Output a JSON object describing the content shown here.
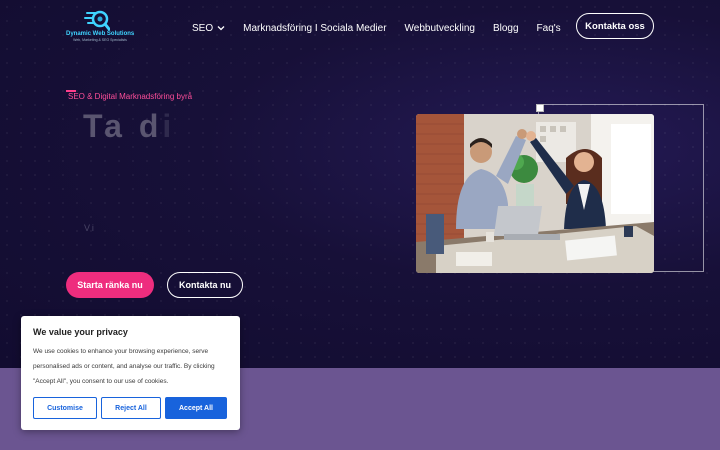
{
  "logo": {
    "name": "Dynamic Web Solutions",
    "tagline": "Web, Marketing & SEO Specialists"
  },
  "nav": {
    "items": [
      {
        "label": "SEO",
        "has_dropdown": true
      },
      {
        "label": "Marknadsföring I Sociala Medier"
      },
      {
        "label": "Webbutveckling"
      },
      {
        "label": "Blogg"
      },
      {
        "label": "Faq's"
      }
    ],
    "cta": "Kontakta oss"
  },
  "hero": {
    "eyebrow": "SEO & Digital Marknadsföring byrå",
    "headline_visible": "Ta d",
    "headline_faded": "i",
    "subtext_visible": "Vi",
    "primary_button": "Starta ränka nu",
    "secondary_button": "Kontakta nu"
  },
  "cookie": {
    "title": "We value your privacy",
    "text": "We use cookies to enhance your browsing experience, serve personalised ads or content, and analyse our traffic. By clicking \"Accept All\", you consent to our use of cookies.",
    "customise": "Customise",
    "reject": "Reject All",
    "accept": "Accept All"
  },
  "colors": {
    "hero_bg": "#171038",
    "lower_bg": "#6b5591",
    "accent_pink": "#ee2d7e",
    "cookie_blue": "#1863dc",
    "logo_cyan": "#3fd3ff"
  }
}
